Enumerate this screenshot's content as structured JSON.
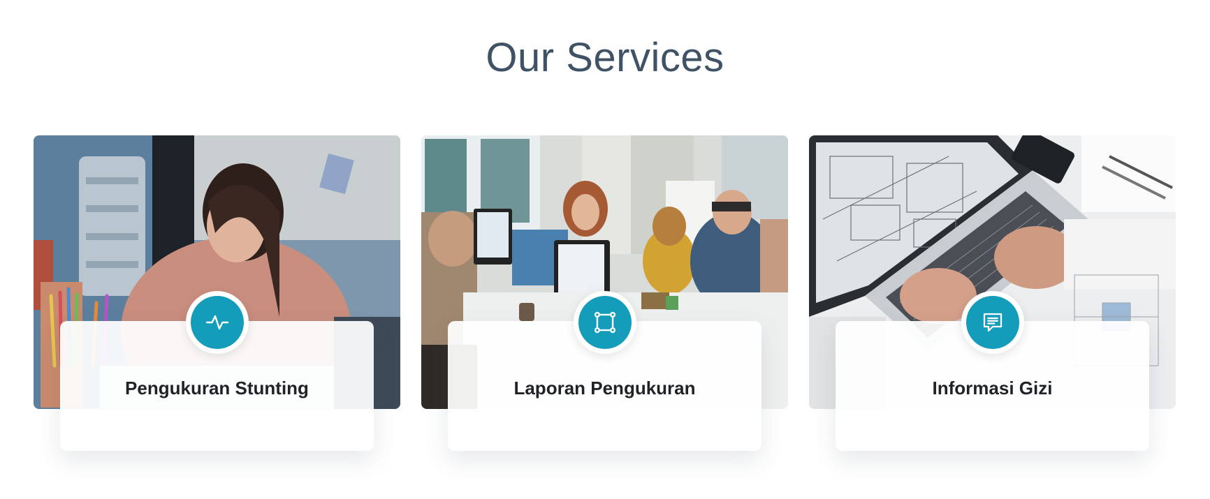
{
  "section": {
    "title": "Our Services"
  },
  "colors": {
    "title": "#3f5266",
    "accent": "#149cbb",
    "card_text": "#1f2328"
  },
  "services": [
    {
      "title": "Pengukuran Stunting",
      "icon": "activity-pulse-icon",
      "image": "woman-drawing-photo"
    },
    {
      "title": "Laporan Pengukuran",
      "icon": "crop-square-nodes-icon",
      "image": "office-team-photo"
    },
    {
      "title": "Informasi Gizi",
      "icon": "message-square-icon",
      "image": "laptop-blueprint-photo"
    }
  ]
}
